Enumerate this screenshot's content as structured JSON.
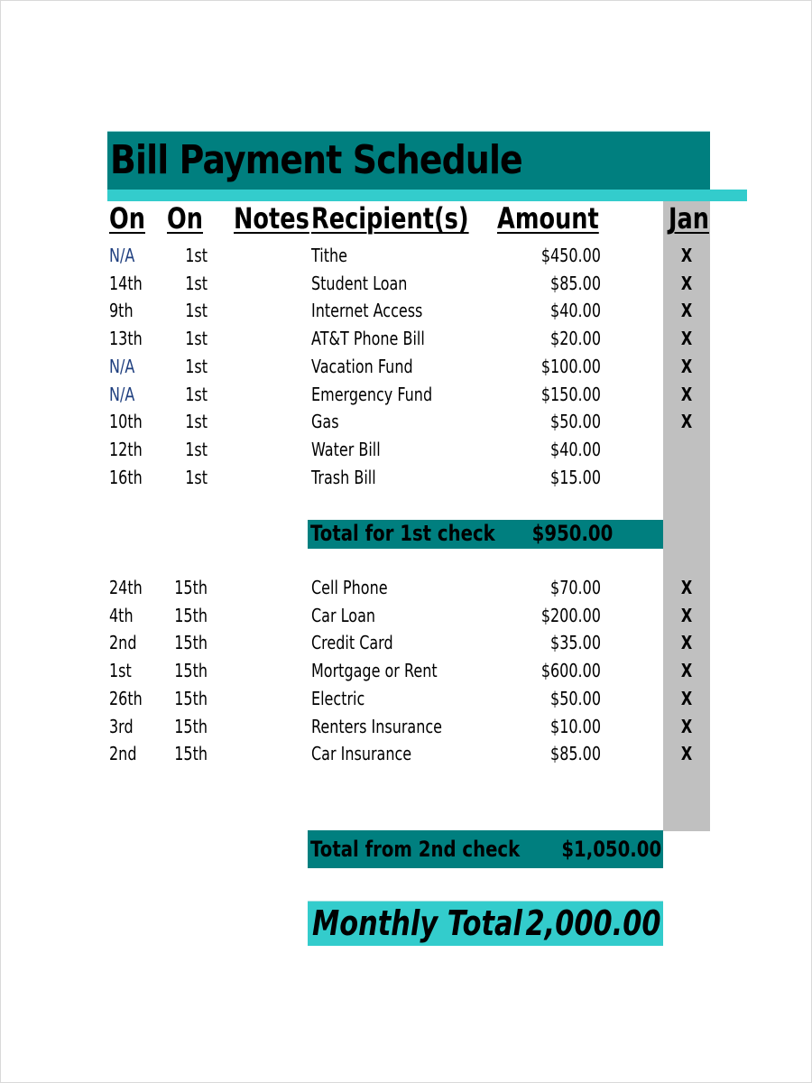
{
  "title": "Bill Payment Schedule",
  "colors": {
    "title_bar": "#007f7f",
    "accent": "#33cccc",
    "month_column": "#c0c0c0",
    "na_text": "#1f3f7f"
  },
  "headers": {
    "due_on": "On",
    "paid_on": "On",
    "notes": "Notes",
    "recipients": "Recipient(s)",
    "amount": "Amount",
    "month": "Jan"
  },
  "check1": {
    "rows": [
      {
        "due": "N/A",
        "paid": "1st",
        "notes": "",
        "recipient": "Tithe",
        "amount": "$450.00",
        "jan": "X"
      },
      {
        "due": "14th",
        "paid": "1st",
        "notes": "",
        "recipient": "Student Loan",
        "amount": "$85.00",
        "jan": "X"
      },
      {
        "due": "9th",
        "paid": "1st",
        "notes": "",
        "recipient": "Internet Access",
        "amount": "$40.00",
        "jan": "X"
      },
      {
        "due": "13th",
        "paid": "1st",
        "notes": "",
        "recipient": "AT&T Phone Bill",
        "amount": "$20.00",
        "jan": "X"
      },
      {
        "due": "N/A",
        "paid": "1st",
        "notes": "",
        "recipient": "Vacation Fund",
        "amount": "$100.00",
        "jan": "X"
      },
      {
        "due": "N/A",
        "paid": "1st",
        "notes": "",
        "recipient": "Emergency Fund",
        "amount": "$150.00",
        "jan": "X"
      },
      {
        "due": "10th",
        "paid": "1st",
        "notes": "",
        "recipient": "Gas",
        "amount": "$50.00",
        "jan": "X"
      },
      {
        "due": "12th",
        "paid": "1st",
        "notes": "",
        "recipient": "Water Bill",
        "amount": "$40.00",
        "jan": ""
      },
      {
        "due": "16th",
        "paid": "1st",
        "notes": "",
        "recipient": "Trash Bill",
        "amount": "$15.00",
        "jan": ""
      }
    ],
    "total_label": "Total for 1st check",
    "total_value": "$950.00"
  },
  "check2": {
    "rows": [
      {
        "due": "24th",
        "paid": "15th",
        "notes": "",
        "recipient": "Cell Phone",
        "amount": "$70.00",
        "jan": "X"
      },
      {
        "due": "4th",
        "paid": "15th",
        "notes": "",
        "recipient": "Car Loan",
        "amount": "$200.00",
        "jan": "X"
      },
      {
        "due": "2nd",
        "paid": "15th",
        "notes": "",
        "recipient": "Credit Card",
        "amount": "$35.00",
        "jan": "X"
      },
      {
        "due": "1st",
        "paid": "15th",
        "notes": "",
        "recipient": "Mortgage or Rent",
        "amount": "$600.00",
        "jan": "X"
      },
      {
        "due": "26th",
        "paid": "15th",
        "notes": "",
        "recipient": "Electric",
        "amount": "$50.00",
        "jan": "X"
      },
      {
        "due": "3rd",
        "paid": "15th",
        "notes": "",
        "recipient": "Renters Insurance",
        "amount": "$10.00",
        "jan": "X"
      },
      {
        "due": "2nd",
        "paid": "15th",
        "notes": "",
        "recipient": "Car Insurance",
        "amount": "$85.00",
        "jan": "X"
      }
    ],
    "total_label": "Total from 2nd check",
    "total_value": "$1,050.00"
  },
  "monthly": {
    "label": "Monthly Total",
    "value": "2,000.00"
  }
}
